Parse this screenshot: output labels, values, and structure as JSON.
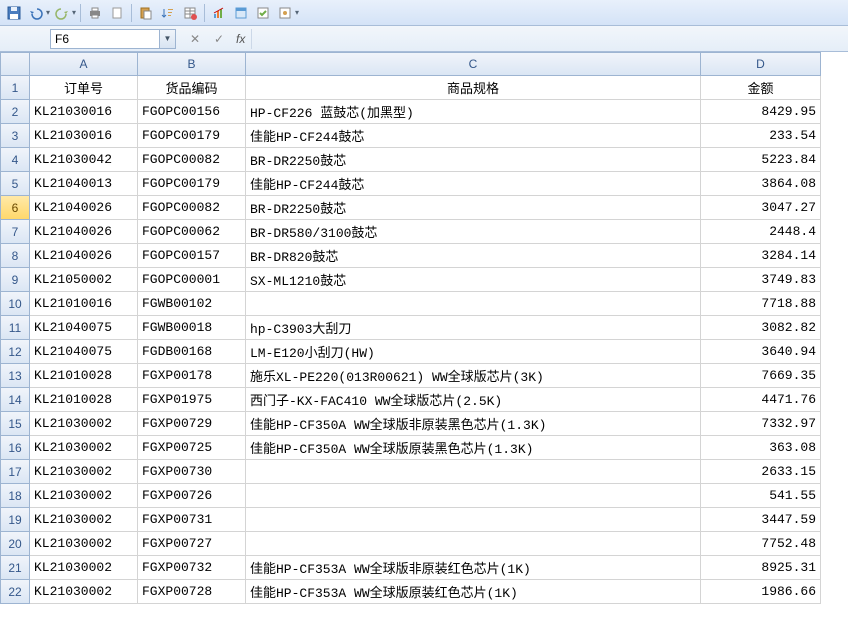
{
  "namebox": "F6",
  "col_headers": [
    "A",
    "B",
    "C",
    "D"
  ],
  "table_headers": {
    "A": "订单号",
    "B": "货品编码",
    "C": "商品规格",
    "D": "金额"
  },
  "rows": [
    {
      "n": "2",
      "a": "KL21030016",
      "b": "FGOPC00156",
      "c": "HP-CF226 蓝鼓芯(加黑型)",
      "d": "8429.95"
    },
    {
      "n": "3",
      "a": "KL21030016",
      "b": "FGOPC00179",
      "c": "佳能HP-CF244鼓芯",
      "d": "233.54"
    },
    {
      "n": "4",
      "a": "KL21030042",
      "b": "FGOPC00082",
      "c": "BR-DR2250鼓芯",
      "d": "5223.84"
    },
    {
      "n": "5",
      "a": "KL21040013",
      "b": "FGOPC00179",
      "c": "佳能HP-CF244鼓芯",
      "d": "3864.08"
    },
    {
      "n": "6",
      "a": "KL21040026",
      "b": "FGOPC00082",
      "c": "BR-DR2250鼓芯",
      "d": "3047.27"
    },
    {
      "n": "7",
      "a": "KL21040026",
      "b": "FGOPC00062",
      "c": "BR-DR580/3100鼓芯",
      "d": "2448.4"
    },
    {
      "n": "8",
      "a": "KL21040026",
      "b": "FGOPC00157",
      "c": "BR-DR820鼓芯",
      "d": "3284.14"
    },
    {
      "n": "9",
      "a": "KL21050002",
      "b": "FGOPC00001",
      "c": "SX-ML1210鼓芯",
      "d": "3749.83"
    },
    {
      "n": "10",
      "a": "KL21010016",
      "b": "FGWB00102",
      "c": "",
      "d": "7718.88"
    },
    {
      "n": "11",
      "a": "KL21040075",
      "b": "FGWB00018",
      "c": "hp-C3903大刮刀",
      "d": "3082.82"
    },
    {
      "n": "12",
      "a": "KL21040075",
      "b": "FGDB00168",
      "c": "LM-E120小刮刀(HW)",
      "d": "3640.94"
    },
    {
      "n": "13",
      "a": "KL21010028",
      "b": "FGXP00178",
      "c": "施乐XL-PE220(013R00621) WW全球版芯片(3K)",
      "d": "7669.35"
    },
    {
      "n": "14",
      "a": "KL21010028",
      "b": "FGXP01975",
      "c": "西门子-KX-FAC410 WW全球版芯片(2.5K)",
      "d": "4471.76"
    },
    {
      "n": "15",
      "a": "KL21030002",
      "b": "FGXP00729",
      "c": "佳能HP-CF350A WW全球版非原装黑色芯片(1.3K)",
      "d": "7332.97"
    },
    {
      "n": "16",
      "a": "KL21030002",
      "b": "FGXP00725",
      "c": "佳能HP-CF350A WW全球版原装黑色芯片(1.3K)",
      "d": "363.08"
    },
    {
      "n": "17",
      "a": "KL21030002",
      "b": "FGXP00730",
      "c": "",
      "d": "2633.15"
    },
    {
      "n": "18",
      "a": "KL21030002",
      "b": "FGXP00726",
      "c": "",
      "d": "541.55"
    },
    {
      "n": "19",
      "a": "KL21030002",
      "b": "FGXP00731",
      "c": "",
      "d": "3447.59"
    },
    {
      "n": "20",
      "a": "KL21030002",
      "b": "FGXP00727",
      "c": "",
      "d": "7752.48"
    },
    {
      "n": "21",
      "a": "KL21030002",
      "b": "FGXP00732",
      "c": "佳能HP-CF353A WW全球版非原装红色芯片(1K)",
      "d": "8925.31"
    },
    {
      "n": "22",
      "a": "KL21030002",
      "b": "FGXP00728",
      "c": "佳能HP-CF353A WW全球版原装红色芯片(1K)",
      "d": "1986.66"
    }
  ],
  "active_row": "6"
}
